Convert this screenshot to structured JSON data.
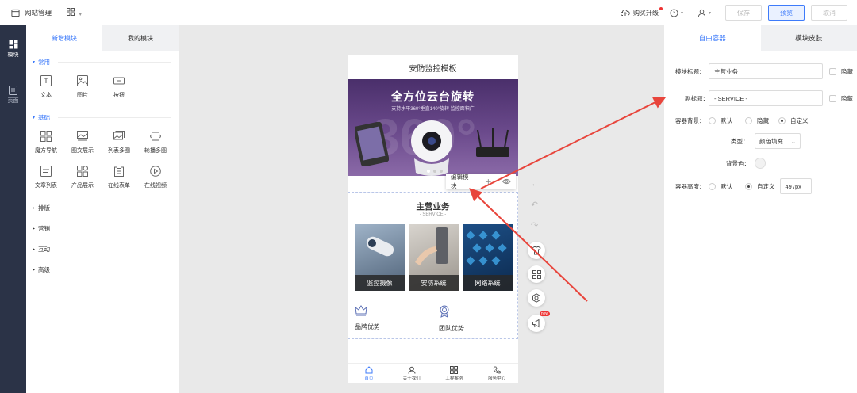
{
  "topbar": {
    "site_title": "网站管理",
    "upgrade_label": "购买升级",
    "save_label": "保存",
    "preview_label": "预览",
    "cancel_label": "取消"
  },
  "iconbar": {
    "items": [
      {
        "label": "模块",
        "icon": "module-icon"
      },
      {
        "label": "页面",
        "icon": "page-icon"
      }
    ]
  },
  "leftpanel": {
    "tabs": [
      "新增模块",
      "我的模块"
    ],
    "sections": {
      "common": {
        "title": "常用",
        "items": [
          "文本",
          "图片",
          "按钮"
        ]
      },
      "basic": {
        "title": "基础",
        "items": [
          "魔方导航",
          "图文展示",
          "列表多图",
          "轮播多图",
          "文章列表",
          "产品展示",
          "在线表单",
          "在线视频"
        ]
      },
      "collapsed": [
        "排版",
        "营销",
        "互动",
        "高级"
      ]
    }
  },
  "phone": {
    "title": "安防监控模板",
    "banner": {
      "headline": "全方位云台旋转",
      "subline": "支持水平360°垂直140°旋转  监控面积广",
      "deco": "360°"
    },
    "edit_popup": {
      "label": "编辑模块"
    },
    "services": {
      "title": "主营业务",
      "subtitle": "- SERVICE -",
      "cards": [
        "监控摄像",
        "安防系统",
        "网络系统"
      ]
    },
    "advantages": [
      "品牌优势",
      "团队优势"
    ],
    "tabbar": [
      {
        "label": "首页",
        "icon": "home-icon"
      },
      {
        "label": "关于我们",
        "icon": "user-icon"
      },
      {
        "label": "工程案例",
        "icon": "grid-icon"
      },
      {
        "label": "服务中心",
        "icon": "phone-icon"
      }
    ]
  },
  "rightpanel": {
    "tabs": [
      "自由容器",
      "模块皮肤"
    ],
    "title_label": "模块标题：",
    "title_value": "主营业务",
    "hide_label": "隐藏",
    "subtitle_label": "副标题：",
    "subtitle_value": "- SERVICE -",
    "bg_label": "容器背景：",
    "bg_options": [
      "默认",
      "隐藏",
      "自定义"
    ],
    "bg_selected": "自定义",
    "type_label": "类型：",
    "type_value": "颜色填充",
    "bgcolor_label": "背景色：",
    "height_label": "容器高度：",
    "height_options": [
      "默认",
      "自定义"
    ],
    "height_selected": "自定义",
    "height_value": "497px"
  },
  "colors": {
    "accent": "#3e7bfa",
    "sidebar": "#2b3347",
    "annotation_arrow": "#e8453c"
  }
}
